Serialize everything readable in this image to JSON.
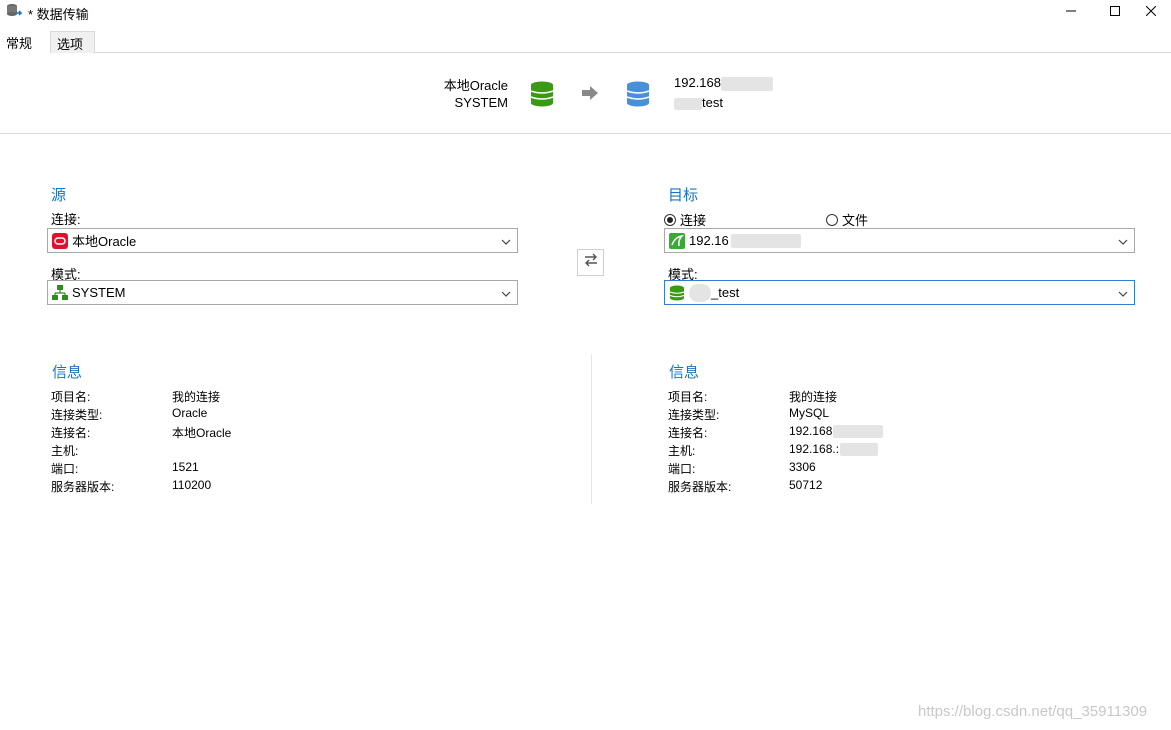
{
  "window": {
    "title": "* 数据传输",
    "icons": {
      "app": "database-transfer-icon",
      "minimize": "minimize-icon",
      "maximize": "maximize-icon",
      "close": "close-icon"
    }
  },
  "tabs": [
    {
      "label": "常规",
      "active": true
    },
    {
      "label": "选项",
      "active": false
    }
  ],
  "header": {
    "source_connection": "本地Oracle",
    "source_schema": "SYSTEM",
    "target_host": "192.168",
    "target_db": "test",
    "source_color": "#3a9a16",
    "target_color": "#4a90d9"
  },
  "source": {
    "title": "源",
    "connection_label": "连接:",
    "connection_value": "本地Oracle",
    "schema_label": "模式:",
    "schema_value": "SYSTEM"
  },
  "target": {
    "title": "目标",
    "radio_connection": "连接",
    "radio_file": "文件",
    "selected_radio": "连接",
    "connection_value": "192.16",
    "schema_label": "模式:",
    "schema_value": "_test"
  },
  "source_info": {
    "title": "信息",
    "rows": [
      {
        "key": "项目名:",
        "value": "我的连接"
      },
      {
        "key": "连接类型:",
        "value": "Oracle"
      },
      {
        "key": "连接名:",
        "value": "本地Oracle"
      },
      {
        "key": "主机:",
        "value": ""
      },
      {
        "key": "端口:",
        "value": "1521"
      },
      {
        "key": "服务器版本:",
        "value": "110200"
      }
    ]
  },
  "target_info": {
    "title": "信息",
    "rows": [
      {
        "key": "项目名:",
        "value": "我的连接"
      },
      {
        "key": "连接类型:",
        "value": "MySQL"
      },
      {
        "key": "连接名:",
        "value": "192.168"
      },
      {
        "key": "主机:",
        "value": "192.168.:"
      },
      {
        "key": "端口:",
        "value": "3306"
      },
      {
        "key": "服务器版本:",
        "value": "50712"
      }
    ]
  },
  "accent_color": "#1a74c2",
  "watermark": "https://blog.csdn.net/qq_35911309"
}
